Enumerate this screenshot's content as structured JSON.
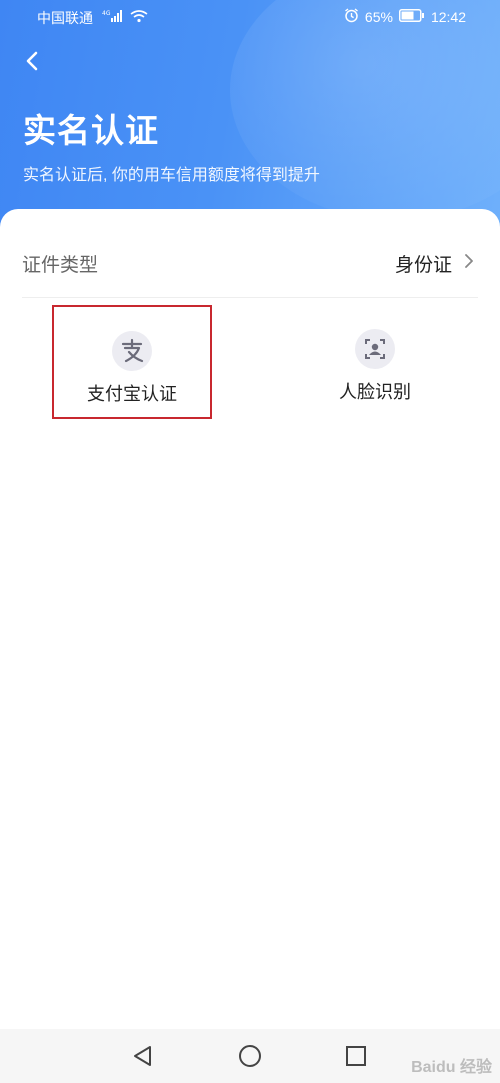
{
  "status_bar": {
    "carrier": "中国联通",
    "network": "4G",
    "battery": "65%",
    "time": "12:42"
  },
  "header": {
    "title": "实名认证",
    "subtitle": "实名认证后, 你的用车信用额度将得到提升"
  },
  "document": {
    "label": "证件类型",
    "value": "身份证"
  },
  "options": [
    {
      "label": "支付宝认证",
      "icon": "alipay-icon"
    },
    {
      "label": "人脸识别",
      "icon": "face-scan-icon"
    }
  ],
  "watermark": "Baidu 经验",
  "colors": {
    "header_blue": "#3f86f3",
    "highlight_red": "#c8282f"
  }
}
